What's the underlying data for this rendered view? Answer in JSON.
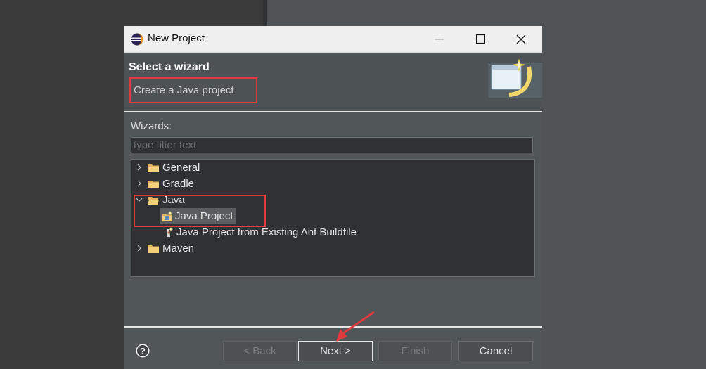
{
  "window": {
    "title": "New Project"
  },
  "header": {
    "title": "Select a wizard",
    "description": "Create a Java project"
  },
  "wizards": {
    "label": "Wizards:",
    "filter_placeholder": "type filter text",
    "tree": [
      {
        "label": "General",
        "expanded": false,
        "icon": "folder-icon"
      },
      {
        "label": "Gradle",
        "expanded": false,
        "icon": "folder-icon"
      },
      {
        "label": "Java",
        "expanded": true,
        "icon": "folder-icon",
        "children": [
          {
            "label": "Java Project",
            "selected": true,
            "icon": "java-project-icon"
          },
          {
            "label": "Java Project from Existing Ant Buildfile",
            "icon": "ant-buildfile-icon"
          }
        ]
      },
      {
        "label": "Maven",
        "expanded": false,
        "icon": "folder-icon"
      }
    ]
  },
  "buttons": {
    "back": "< Back",
    "next": "Next >",
    "finish": "Finish",
    "cancel": "Cancel"
  },
  "colors": {
    "highlight": "#e0393e",
    "dialog_bg": "#515658",
    "tree_bg": "#2f3133"
  }
}
